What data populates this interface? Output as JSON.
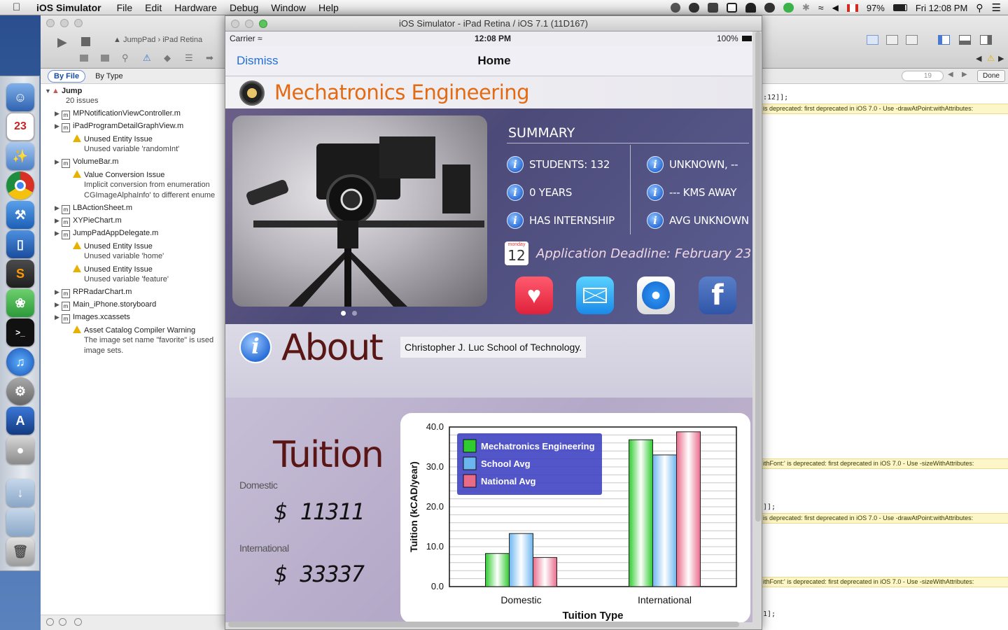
{
  "menubar": {
    "app_name": "iOS Simulator",
    "items": [
      "File",
      "Edit",
      "Hardware",
      "Debug",
      "Window",
      "Help"
    ],
    "battery": "97%",
    "clock": "Fri 12:08 PM"
  },
  "xcode": {
    "breadcrumb": [
      "JumpPad",
      "iPad Retina"
    ],
    "nav_tabs": {
      "by_file": "By File",
      "by_type": "By Type"
    },
    "issues": [
      {
        "kind": "project",
        "label": "Jump",
        "sub": "20 issues"
      },
      {
        "kind": "file",
        "label": "MPNotificationViewController.m"
      },
      {
        "kind": "file",
        "label": "iPadProgramDetailGraphView.m"
      },
      {
        "kind": "warning",
        "label": "Unused Entity Issue",
        "sub": "Unused variable 'randomInt'"
      },
      {
        "kind": "file",
        "label": "VolumeBar.m"
      },
      {
        "kind": "warning",
        "label": "Value Conversion Issue",
        "sub": "Implicit conversion from enumeration",
        "sub2": "CGImageAlphaInfo' to different enume"
      },
      {
        "kind": "file",
        "label": "LBActionSheet.m"
      },
      {
        "kind": "file",
        "label": "XYPieChart.m"
      },
      {
        "kind": "file",
        "label": "JumpPadAppDelegate.m"
      },
      {
        "kind": "warning",
        "label": "Unused Entity Issue",
        "sub": "Unused variable 'home'"
      },
      {
        "kind": "warning",
        "label": "Unused Entity Issue",
        "sub": "Unused variable 'feature'"
      },
      {
        "kind": "file",
        "label": "RPRadarChart.m"
      },
      {
        "kind": "file",
        "label": "Main_iPhone.storyboard"
      },
      {
        "kind": "file",
        "label": "Images.xcassets"
      },
      {
        "kind": "warning",
        "label": "Asset Catalog Compiler Warning",
        "sub": "The image set name \"favorite\" is used",
        "sub2": "image sets."
      }
    ],
    "find_count": "19",
    "done_label": "Done",
    "code_lines": [
      ":12]];",
      "]];",
      "1];"
    ],
    "warnings": [
      "is deprecated: first deprecated in iOS 7.0 - Use -drawAtPoint:withAttributes:",
      "ithFont:' is deprecated: first deprecated in iOS 7.0 - Use -sizeWithAttributes:",
      "is deprecated: first deprecated in iOS 7.0 - Use -drawAtPoint:withAttributes:",
      "ithFont:' is deprecated: first deprecated in iOS 7.0 - Use -sizeWithAttributes:"
    ]
  },
  "simulator": {
    "window_title": "iOS Simulator - iPad Retina / iOS 7.1 (11D167)",
    "status": {
      "carrier": "Carrier",
      "time": "12:08 PM",
      "battery": "100%"
    },
    "nav": {
      "dismiss": "Dismiss",
      "title": "Home"
    },
    "program": "Mechatronics Engineering",
    "summary": {
      "heading": "SUMMARY",
      "left": [
        "STUDENTS: 132",
        "0 YEARS",
        "HAS INTERNSHIP"
      ],
      "right": [
        "UNKNOWN, --",
        "--- KMS AWAY",
        "AVG UNKNOWN"
      ],
      "calendar_day": "monday",
      "calendar_date": "12",
      "deadline": "Application Deadline: February 23"
    },
    "about": {
      "title": "About",
      "school": "Christopher J. Luc School of Technology."
    },
    "tuition": {
      "title": "Tuition",
      "domestic_label": "Domestic",
      "domestic_value": "$ 11311",
      "international_label": "International",
      "international_value": "$ 33337"
    }
  },
  "chart_data": {
    "type": "bar",
    "categories": [
      "Domestic",
      "International"
    ],
    "series": [
      {
        "name": "Mechatronics Engineering",
        "values": [
          8.3,
          36.8
        ],
        "color": "#2ecc2e"
      },
      {
        "name": "School Avg",
        "values": [
          13.3,
          33.0
        ],
        "color": "#6cb6f0"
      },
      {
        "name": "National Avg",
        "values": [
          7.3,
          38.8
        ],
        "color": "#ea6a8a"
      }
    ],
    "xlabel": "Tuition Type",
    "ylabel": "Tuition (kCAD/year)",
    "ylim": [
      0,
      40
    ],
    "yticks": [
      "0.0",
      "10.0",
      "20.0",
      "30.0",
      "40.0"
    ],
    "grid": true,
    "legend": "top-left"
  }
}
